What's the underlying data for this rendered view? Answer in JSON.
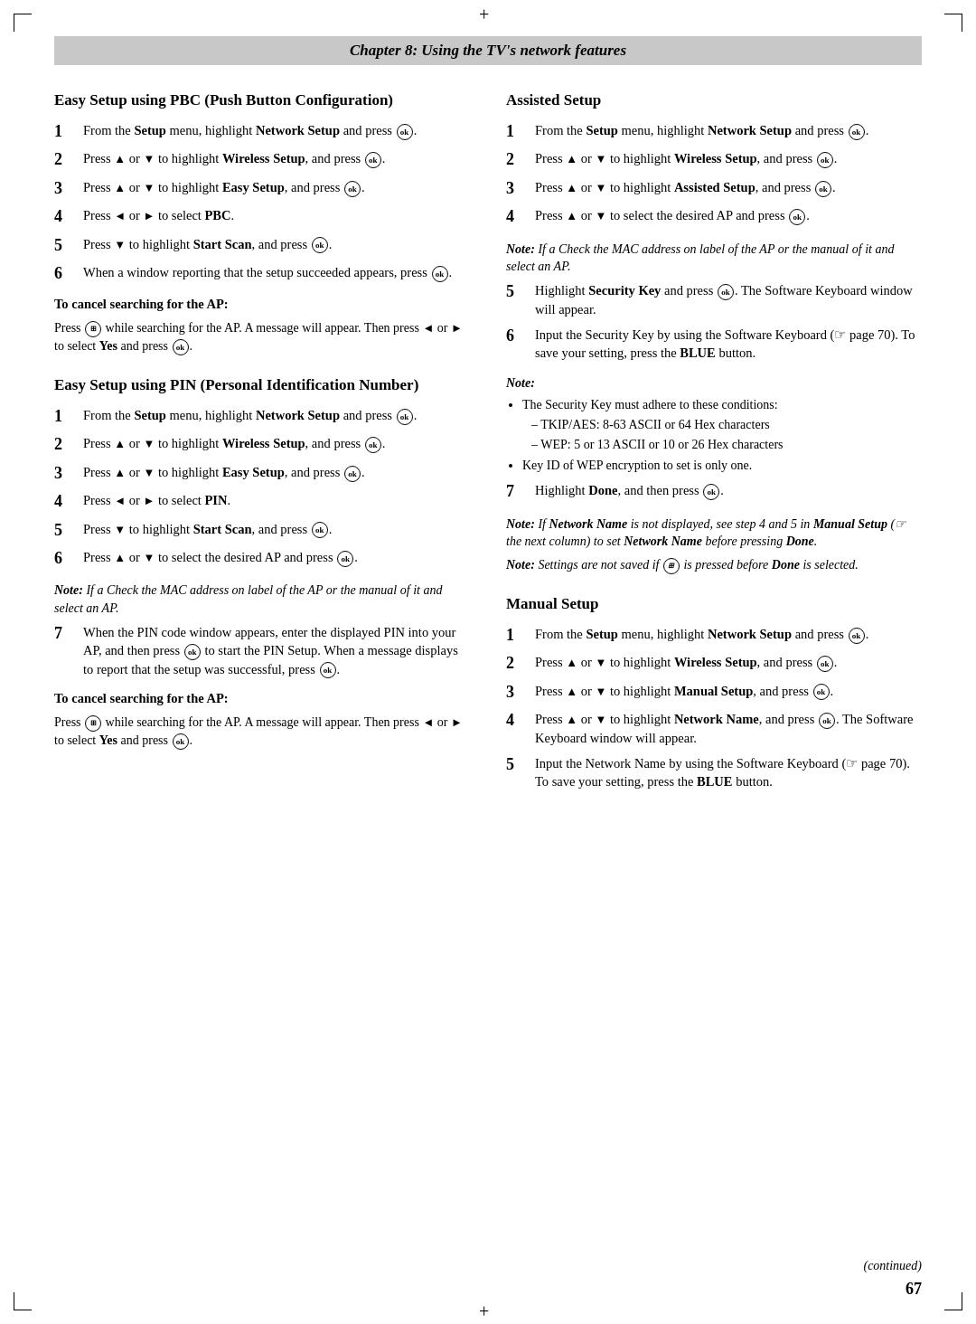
{
  "page": {
    "chapter_header": "Chapter 8: Using the TV's network features",
    "page_number": "67",
    "continued_label": "(continued)"
  },
  "left_col": {
    "section1": {
      "title": "Easy Setup using PBC (Push Button Configuration)",
      "steps": [
        {
          "num": "1",
          "content": "From the <b>Setup</b> menu, highlight <b>Network Setup</b> and press OK."
        },
        {
          "num": "2",
          "content": "Press ▲ or ▼ to highlight <b>Wireless Setup</b>, and press OK."
        },
        {
          "num": "3",
          "content": "Press ▲ or ▼ to highlight <b>Easy Setup</b>, and press OK."
        },
        {
          "num": "4",
          "content": "Press ◄ or ► to select <b>PBC</b>."
        },
        {
          "num": "5",
          "content": "Press ▼ to highlight <b>Start Scan</b>, and press OK."
        },
        {
          "num": "6",
          "content": "When a window reporting that the setup succeeded appears, press OK."
        }
      ],
      "cancel_heading": "To cancel searching for the AP:",
      "cancel_text": "Press MENU while searching for the AP. A message will appear. Then press ◄ or ► to select <b>Yes</b> and press OK."
    },
    "section2": {
      "title": "Easy Setup using PIN (Personal Identification Number)",
      "steps": [
        {
          "num": "1",
          "content": "From the <b>Setup</b> menu, highlight <b>Network Setup</b> and press OK."
        },
        {
          "num": "2",
          "content": "Press ▲ or ▼ to highlight <b>Wireless Setup</b>, and press OK."
        },
        {
          "num": "3",
          "content": "Press ▲ or ▼ to highlight <b>Easy Setup</b>, and press OK."
        },
        {
          "num": "4",
          "content": "Press ◄ or ► to select <b>PIN</b>."
        },
        {
          "num": "5",
          "content": "Press ▼ to highlight <b>Start Scan</b>, and press OK."
        },
        {
          "num": "6",
          "content": "Press ▲ or ▼ to select the desired AP and press OK."
        }
      ],
      "note_italic": "Note: If a Check the MAC address on label of the AP or the manual of it and select an AP.",
      "step7": {
        "num": "7",
        "content": "When the PIN code window appears, enter the displayed PIN into your AP, and then press OK to start the PIN Setup. When a message displays to report that the setup was successful, press OK."
      },
      "cancel_heading": "To cancel searching for the AP:",
      "cancel_text": "Press MENU while searching for the AP. A message will appear. Then press ◄ or ► to select <b>Yes</b> and press OK."
    }
  },
  "right_col": {
    "section3": {
      "title": "Assisted Setup",
      "steps": [
        {
          "num": "1",
          "content": "From the <b>Setup</b> menu, highlight <b>Network Setup</b> and press OK."
        },
        {
          "num": "2",
          "content": "Press ▲ or ▼ to highlight <b>Wireless Setup</b>, and press OK."
        },
        {
          "num": "3",
          "content": "Press ▲ or ▼ to highlight <b>Assisted Setup</b>, and press OK."
        },
        {
          "num": "4",
          "content": "Press ▲ or ▼ to select the desired AP and press OK."
        }
      ],
      "note_after4": "Note: If a Check the MAC address on label of the AP or the manual of it and select an AP.",
      "step5": {
        "num": "5",
        "content": "Highlight <b>Security Key</b> and press OK. The Software Keyboard window will appear."
      },
      "step6": {
        "num": "6",
        "content": "Input the Security Key by using the Software Keyboard (☞ page 70). To save your setting, press the <b>BLUE</b> button."
      },
      "note_block": {
        "label": "Note:",
        "bullets": [
          {
            "text": "The Security Key must adhere to these conditions:",
            "sub": [
              "TKIP/AES: 8-63 ASCII or 64 Hex characters",
              "WEP: 5 or 13 ASCII or 10 or 26 Hex characters"
            ]
          },
          {
            "text": "Key ID of WEP encryption to set is only one.",
            "sub": []
          }
        ]
      },
      "step7": {
        "num": "7",
        "content": "Highlight <b>Done</b>, and then press OK."
      },
      "note_after7": "Note: If <b>Network Name</b> is not displayed, see step 4 and 5 in <b>Manual Setup</b> (☞ the next column) to set <b>Network Name</b> before pressing <b>Done</b>.",
      "note_saved": "Note: Settings are not saved if MENU is pressed before <b>Done</b> is selected."
    },
    "section4": {
      "title": "Manual Setup",
      "steps": [
        {
          "num": "1",
          "content": "From the <b>Setup</b> menu, highlight <b>Network Setup</b> and press OK."
        },
        {
          "num": "2",
          "content": "Press ▲ or ▼ to highlight <b>Wireless Setup</b>, and press OK."
        },
        {
          "num": "3",
          "content": "Press ▲ or ▼ to highlight <b>Manual Setup</b>, and press OK."
        },
        {
          "num": "4",
          "content": "Press ▲ or ▼ to highlight <b>Network Name</b>, and press OK. The Software Keyboard window will appear."
        },
        {
          "num": "5",
          "content": "Input the Network Name by using the Software Keyboard (☞ page 70). To save your setting, press the <b>BLUE</b> button."
        }
      ]
    }
  }
}
